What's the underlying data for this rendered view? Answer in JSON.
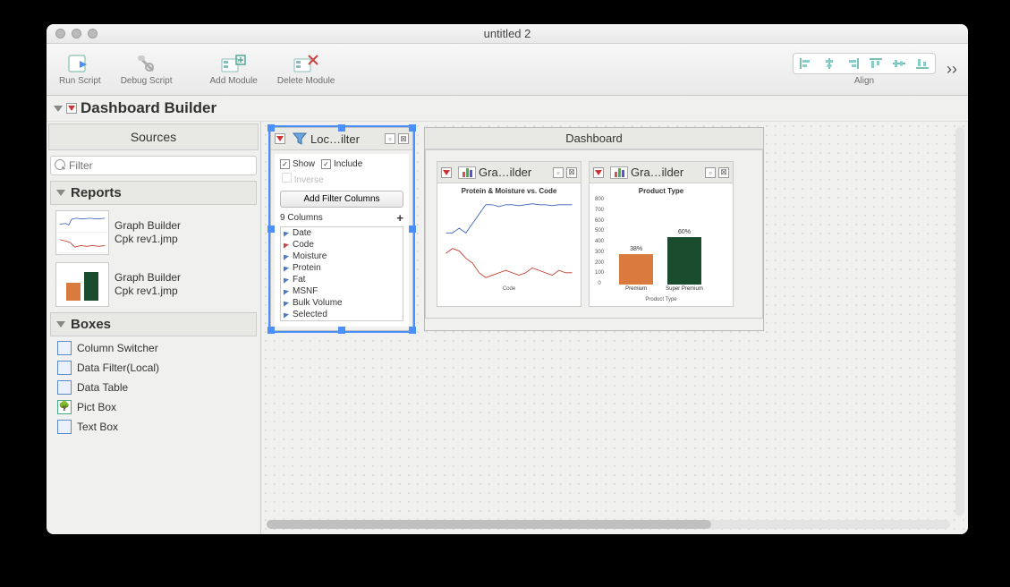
{
  "window": {
    "title": "untitled 2"
  },
  "toolbar": {
    "run_script": "Run Script",
    "debug_script": "Debug Script",
    "add_module": "Add Module",
    "delete_module": "Delete Module",
    "align": "Align"
  },
  "header": {
    "title": "Dashboard Builder"
  },
  "sidebar": {
    "sources": "Sources",
    "filter_placeholder": "Filter",
    "reports_title": "Reports",
    "reports": [
      {
        "line1": "Graph Builder",
        "line2": "Cpk rev1.jmp"
      },
      {
        "line1": "Graph Builder",
        "line2": "Cpk rev1.jmp"
      }
    ],
    "boxes_title": "Boxes",
    "boxes": [
      {
        "label": "Column Switcher"
      },
      {
        "label": "Data Filter(Local)"
      },
      {
        "label": "Data Table"
      },
      {
        "label": "Pict Box"
      },
      {
        "label": "Text Box"
      }
    ]
  },
  "filter_module": {
    "title": "Loc…ilter",
    "show": "Show",
    "include": "Include",
    "inverse": "Inverse",
    "add_btn": "Add Filter Columns",
    "cols_count": "9 Columns",
    "columns": [
      "Date",
      "Code",
      "Moisture",
      "Protein",
      "Fat",
      "MSNF",
      "Bulk Volume",
      "Selected"
    ]
  },
  "dashboard": {
    "title": "Dashboard",
    "graph_title": "Gra…ilder"
  },
  "chart_data": [
    {
      "type": "line",
      "title": "Protein & Moisture vs. Code",
      "xlabel": "Code",
      "series": [
        {
          "name": "Protein",
          "values": [
            34,
            34,
            34.5,
            34,
            35,
            36,
            37,
            37,
            36.8,
            37,
            37,
            36.9,
            37,
            37.1,
            37,
            37,
            36.9,
            37,
            37,
            37
          ],
          "color": "#3a5fb8"
        },
        {
          "name": "Moisture",
          "values": [
            0.42,
            0.44,
            0.43,
            0.4,
            0.38,
            0.34,
            0.32,
            0.33,
            0.34,
            0.35,
            0.34,
            0.33,
            0.34,
            0.36,
            0.35,
            0.34,
            0.33,
            0.35,
            0.34,
            0.34
          ],
          "color": "#c0392b"
        }
      ]
    },
    {
      "type": "bar",
      "title": "Product Type",
      "xlabel": "Product Type",
      "ylim": [
        0,
        800
      ],
      "yticks": [
        0,
        100,
        200,
        300,
        400,
        500,
        600,
        700,
        800
      ],
      "categories": [
        "Premium",
        "Super Premium"
      ],
      "values": [
        300,
        475
      ],
      "labels": [
        "38%",
        "60%"
      ],
      "colors": [
        "#d97b3e",
        "#1a4d2e"
      ]
    }
  ]
}
